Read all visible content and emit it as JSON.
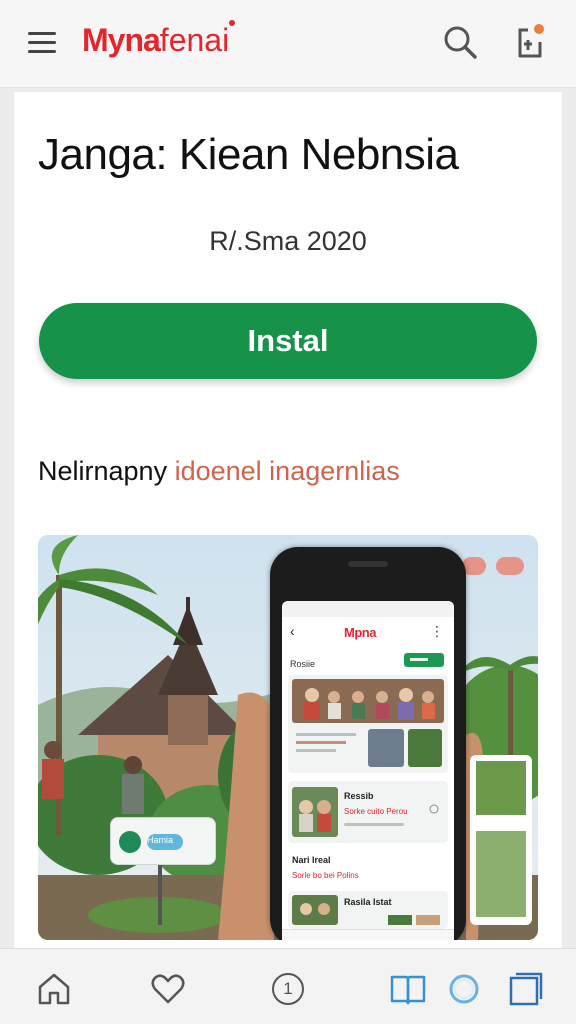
{
  "header": {
    "logo_bold": "Myna",
    "logo_rest": "fenai",
    "menu_icon": "hamburger-menu-icon",
    "search_icon": "search-icon",
    "share_icon": "share-icon"
  },
  "app": {
    "title": "Janga: Kiean Nebnsia",
    "subtitle": "R/.Sma 2020",
    "install_label": "Instal"
  },
  "section": {
    "heading_part1": "Nelirnapny",
    "heading_part2": "idoenel inagernlias"
  },
  "screenshot": {
    "kiosk_label": "Hamia",
    "phone": {
      "logo": "Mpna",
      "label": "Rosiie",
      "cards": [
        {
          "name": "",
          "sub": ""
        },
        {
          "name": "Ressib",
          "sub": "Sorke cuito Perou"
        },
        {
          "name": "Nari Ireal",
          "sub": "Sorle bo bei Polins"
        },
        {
          "name": "Rasila Istat",
          "sub": ""
        }
      ]
    }
  },
  "bottom_nav": {
    "items": [
      "home-icon",
      "heart-icon",
      "info-icon",
      "book-icon",
      "circle-icon",
      "window-icon"
    ],
    "info_glyph": "1"
  },
  "colors": {
    "brand_red": "#e3262b",
    "install_green": "#17924a",
    "accent_orange": "#d0644a",
    "nav_blue": "#3a8fd0"
  }
}
